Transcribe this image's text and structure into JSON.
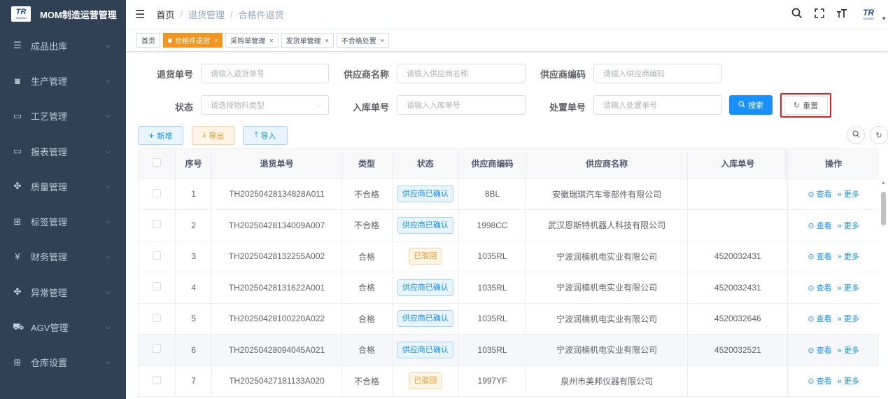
{
  "app": {
    "logo_text": "TR",
    "logo_sub": "TATARIE",
    "title": "MOM制造运营管理"
  },
  "sidebar": {
    "items": [
      {
        "label": "成品出库",
        "icon": "list-icon",
        "glyph": "☰"
      },
      {
        "label": "生产管理",
        "icon": "monitor-icon",
        "glyph": "◙"
      },
      {
        "label": "工艺管理",
        "icon": "table-icon",
        "glyph": "▭"
      },
      {
        "label": "报表管理",
        "icon": "table-icon",
        "glyph": "▭"
      },
      {
        "label": "质量管理",
        "icon": "cert-icon",
        "glyph": "✤"
      },
      {
        "label": "标签管理",
        "icon": "grid-icon",
        "glyph": "⊞"
      },
      {
        "label": "财务管理",
        "icon": "yen-icon",
        "glyph": "¥"
      },
      {
        "label": "异常管理",
        "icon": "cert-icon",
        "glyph": "✤"
      },
      {
        "label": "AGV管理",
        "icon": "cart-icon",
        "glyph": "⛟"
      },
      {
        "label": "仓库设置",
        "icon": "grid-icon",
        "glyph": "⊞"
      }
    ]
  },
  "navbar": {
    "breadcrumb": [
      "首页",
      "退货管理",
      "合格件退货"
    ]
  },
  "tags": [
    {
      "label": "首页",
      "active": false,
      "closable": false
    },
    {
      "label": "合格件退货",
      "active": true,
      "closable": true
    },
    {
      "label": "采购单管理",
      "active": false,
      "closable": true
    },
    {
      "label": "发货单管理",
      "active": false,
      "closable": true
    },
    {
      "label": "不合格处置",
      "active": false,
      "closable": true
    }
  ],
  "search_form": {
    "return_no": {
      "label": "退货单号",
      "placeholder": "请输入退货单号"
    },
    "supplier_name": {
      "label": "供应商名称",
      "placeholder": "请输入供应商名称"
    },
    "supplier_code": {
      "label": "供应商编码",
      "placeholder": "请输入供应商编码"
    },
    "status": {
      "label": "状态",
      "placeholder": "请选择物料类型"
    },
    "inbound_no": {
      "label": "入库单号",
      "placeholder": "请输入入库单号"
    },
    "disposal_no": {
      "label": "处置单号",
      "placeholder": "请输入处置单号"
    },
    "search_label": "搜索",
    "reset_label": "重置"
  },
  "toolbar": {
    "add_label": "新增",
    "export_label": "导出",
    "import_label": "导入"
  },
  "table": {
    "columns": [
      "",
      "序号",
      "退货单号",
      "类型",
      "状态",
      "供应商编码",
      "供应商名称",
      "入库单号",
      "操作"
    ],
    "view_label": "查看",
    "more_label": "更多",
    "rows": [
      {
        "no": "1",
        "return_no": "TH20250428134828A011",
        "type": "不合格",
        "status": "供应商已确认",
        "status_color": "blue",
        "supplier_code": "8BL",
        "supplier_name": "安徽瑞琪汽车零部件有限公司",
        "inbound_no": ""
      },
      {
        "no": "2",
        "return_no": "TH20250428134009A007",
        "type": "不合格",
        "status": "供应商已确认",
        "status_color": "blue",
        "supplier_code": "1998CC",
        "supplier_name": "武汉恩斯特机器人科技有限公司",
        "inbound_no": ""
      },
      {
        "no": "3",
        "return_no": "TH20250428132255A002",
        "type": "合格",
        "status": "已驳回",
        "status_color": "orange",
        "supplier_code": "1035RL",
        "supplier_name": "宁波润楠机电实业有限公司",
        "inbound_no": "4520032431"
      },
      {
        "no": "4",
        "return_no": "TH20250428131622A001",
        "type": "合格",
        "status": "供应商已确认",
        "status_color": "blue",
        "supplier_code": "1035RL",
        "supplier_name": "宁波润楠机电实业有限公司",
        "inbound_no": "4520032431"
      },
      {
        "no": "5",
        "return_no": "TH20250428100220A022",
        "type": "合格",
        "status": "供应商已确认",
        "status_color": "blue",
        "supplier_code": "1035RL",
        "supplier_name": "宁波润楠机电实业有限公司",
        "inbound_no": "4520032646"
      },
      {
        "no": "6",
        "return_no": "TH20250428094045A021",
        "type": "合格",
        "status": "供应商已确认",
        "status_color": "blue",
        "supplier_code": "1035RL",
        "supplier_name": "宁波润楠机电实业有限公司",
        "inbound_no": "4520032521"
      },
      {
        "no": "7",
        "return_no": "TH20250427181133A020",
        "type": "不合格",
        "status": "已驳回",
        "status_color": "orange",
        "supplier_code": "1997YF",
        "supplier_name": "泉州市美邦仪器有限公司",
        "inbound_no": ""
      }
    ]
  }
}
